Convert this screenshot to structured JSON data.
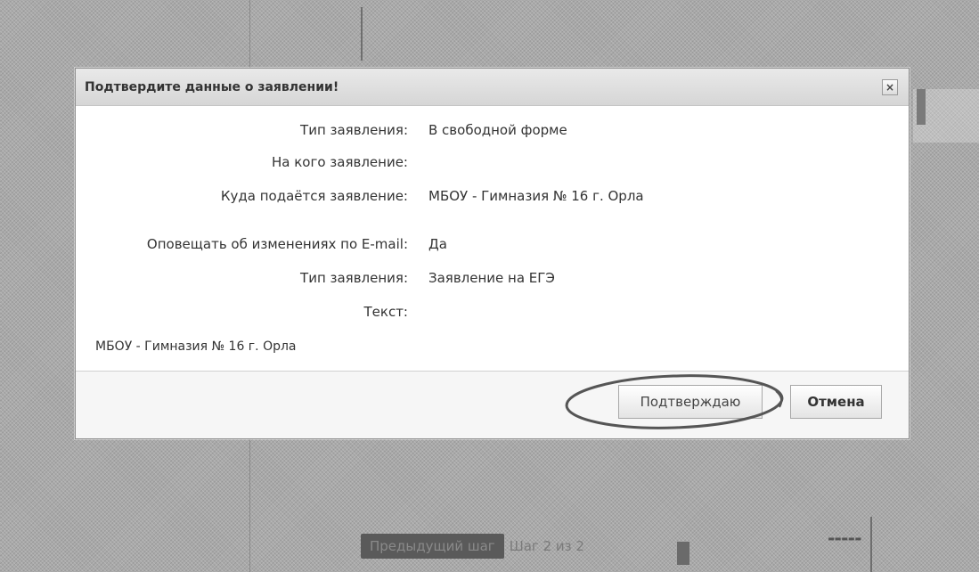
{
  "dialog": {
    "title": "Подтвердите данные о заявлении!",
    "close_label": "×",
    "fields": [
      {
        "label": "Тип заявления:",
        "value": "В свободной форме"
      },
      {
        "label": "На кого заявление:",
        "value": ""
      },
      {
        "label": "Куда подаётся заявление:",
        "value": "МБОУ - Гимназия № 16 г. Орла"
      },
      {
        "label": "Оповещать об изменениях по E-mail:",
        "value": "Да"
      },
      {
        "label": "Тип заявления:",
        "value": "Заявление на ЕГЭ"
      },
      {
        "label": "Текст:",
        "value": ""
      }
    ],
    "text_value": "МБОУ - Гимназия № 16 г. Орла",
    "confirm_label": "Подтверждаю",
    "cancel_label": "Отмена"
  },
  "background": {
    "prev_button_label": "Предыдущий шаг",
    "step_label": "Шаг 2 из 2"
  },
  "colors": {
    "overlay": "#a9a9a9",
    "header": "#dcdcdc",
    "annotation": "#555555"
  }
}
